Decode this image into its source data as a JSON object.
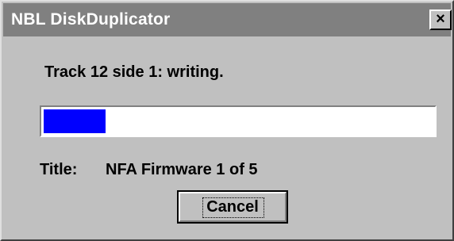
{
  "window": {
    "title": "NBL DiskDuplicator",
    "close_glyph": "×"
  },
  "status": {
    "text": "Track 12 side 1: writing."
  },
  "progress": {
    "fraction": 0.16,
    "fill_color": "#0000ff"
  },
  "disk_title": {
    "label": "Title:",
    "value": "NFA Firmware 1 of 5"
  },
  "buttons": {
    "cancel": "Cancel"
  },
  "colors": {
    "dialog_bg": "#c0c0c0",
    "title_bar_bg": "#808080",
    "title_text": "#ffffff"
  }
}
